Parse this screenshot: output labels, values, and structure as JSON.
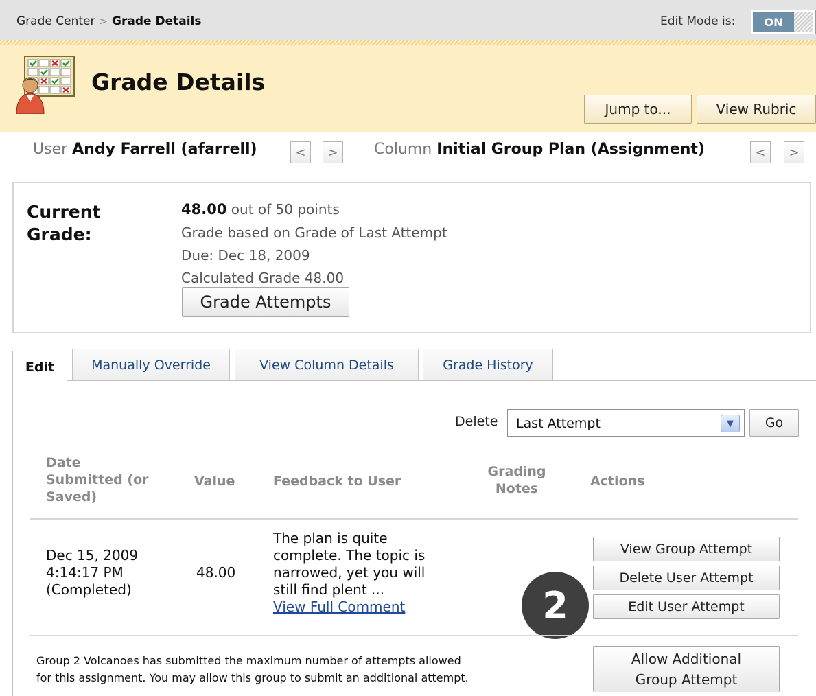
{
  "breadcrumb": {
    "parent": "Grade Center",
    "separator": ">",
    "current": "Grade Details"
  },
  "edit_mode": {
    "label": "Edit Mode is:",
    "state": "ON"
  },
  "header": {
    "title": "Grade Details",
    "icon": "gradebook-user-icon",
    "jump_button": "Jump to...",
    "rubric_button": "View Rubric"
  },
  "nav": {
    "user_label": "User",
    "user_value": "Andy Farrell (afarrell)",
    "column_label": "Column",
    "column_value": "Initial Group Plan (Assignment)",
    "prev_glyph": "<",
    "next_glyph": ">"
  },
  "current_grade": {
    "label_line1": "Current",
    "label_line2": "Grade:",
    "score": "48.00",
    "score_suffix": "out of 50 points",
    "basis": "Grade based on Grade of Last Attempt",
    "due": "Due: Dec 18, 2009",
    "calculated": "Calculated Grade  48.00",
    "attempts_button": "Grade Attempts"
  },
  "tabs": [
    "Edit",
    "Manually Override",
    "View Column Details",
    "Grade History"
  ],
  "delete_row": {
    "label": "Delete",
    "selected": "Last Attempt",
    "go_button": "Go"
  },
  "table": {
    "headers": {
      "date": [
        "Date",
        "Submitted (or",
        "Saved)"
      ],
      "value": "Value",
      "feedback": "Feedback to User",
      "notes": [
        "Grading",
        "Notes"
      ],
      "actions": "Actions"
    },
    "row": {
      "date": [
        "Dec 15, 2009",
        "4:14:17 PM",
        "(Completed)"
      ],
      "value": "48.00",
      "feedback": [
        "The plan is quite",
        "complete. The topic is",
        "narrowed, yet you will",
        "still find plent ..."
      ],
      "feedback_link": "View Full Comment",
      "actions": [
        "View Group Attempt",
        "Delete User Attempt",
        "Edit User Attempt"
      ]
    }
  },
  "callout": "2",
  "footer_note": {
    "line1": "Group 2 Volcanoes has submitted the maximum number of attempts allowed",
    "line2": "for this assignment. You may allow this group to submit an additional attempt.",
    "button_line1": "Allow Additional",
    "button_line2": "Group Attempt"
  }
}
